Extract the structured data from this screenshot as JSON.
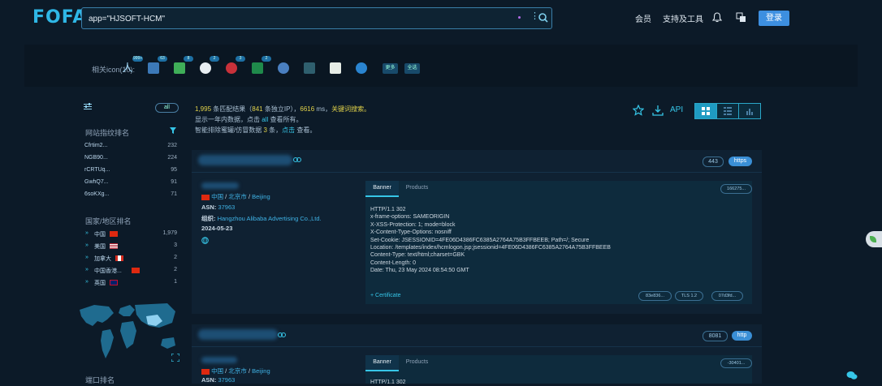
{
  "header": {
    "logo": "FOFA",
    "query": "app=\"HJSOFT-HCM\"",
    "nav": [
      "会员",
      "支持及工具"
    ],
    "login": "登录"
  },
  "filter": {
    "label": "相关icon(10):",
    "badges": [
      "999+",
      "63",
      "8",
      "2",
      "3",
      "2"
    ],
    "more": "更多",
    "select_all": "全选"
  },
  "sidebar": {
    "all_label": "all",
    "fingerprint_heading": "网站指纹排名",
    "fingerprints": [
      {
        "name": "Cfrtim2...",
        "count": "232"
      },
      {
        "name": "NGB90...",
        "count": "224"
      },
      {
        "name": "rCRTUq...",
        "count": "95"
      },
      {
        "name": "GwhQ7...",
        "count": "91"
      },
      {
        "name": "6soKXg...",
        "count": "71"
      }
    ],
    "country_heading": "国家/地区排名",
    "countries": [
      {
        "name": "中国",
        "count": "1,979",
        "flag": "cn"
      },
      {
        "name": "美国",
        "count": "3",
        "flag": "us"
      },
      {
        "name": "加拿大",
        "count": "2",
        "flag": "ca"
      },
      {
        "name": "中国香港...",
        "count": "2",
        "flag": "hk"
      },
      {
        "name": "英国",
        "count": "1",
        "flag": "uk"
      }
    ],
    "port_heading": "端口排名"
  },
  "summary": {
    "total": "1,995",
    "line1_a": " 条匹配结果（",
    "ips": "841",
    "line1_b": " 条独立IP），",
    "ms": "6616",
    "line1_c": " ms，",
    "keyword": "关键词搜索。",
    "line2_a": "显示一年内数据，点击 ",
    "line2_all": "all",
    "line2_b": " 查看所有。",
    "line3_a": "智能排除蜜罐/仿冒数据 ",
    "line3_num": "3",
    "line3_b": " 条，",
    "line3_click": "点击",
    "line3_c": " 查看。"
  },
  "toolbar": {
    "api": "API"
  },
  "results": [
    {
      "port": "443",
      "protocol": "https",
      "country": "中国",
      "city": "北京市",
      "district": "Beijing",
      "asn_label": "ASN:",
      "asn": "37963",
      "org_label": "组织:",
      "org": "Hangzhou Alibaba Advertising Co.,Ltd.",
      "date": "2024-05-23",
      "tab_banner": "Banner",
      "tab_products": "Products",
      "hash": "166275...",
      "banner": "HTTP/1.1 302\nx-frame-options: SAMEORIGIN\nX-XSS-Protection: 1; mode=block\nX-Content-Type-Options: nosniff\nSet-Cookie: JSESSIONID=4FE06D4386FC6385A2764A75B3FFBEEB; Path=/; Secure\nLocation: /templates/index/hcmlogon.jsp;jsessionid=4FE06D4386FC6385A2764A75B3FFBEEB\nContent-Type: text/html;charset=GBK\nContent-Length: 0\nDate: Thu, 23 May 2024 08:54:50 GMT",
      "certificate": "+ Certificate",
      "tags": [
        "83e836...",
        "TLS 1.2",
        "07d3fd..."
      ]
    },
    {
      "port": "8081",
      "protocol": "http",
      "country": "中国",
      "city": "北京市",
      "district": "Beijing",
      "asn_label": "ASN:",
      "asn": "37963",
      "tab_banner": "Banner",
      "tab_products": "Products",
      "hash": "-30401...",
      "banner_first": "HTTP/1.1 302"
    }
  ]
}
